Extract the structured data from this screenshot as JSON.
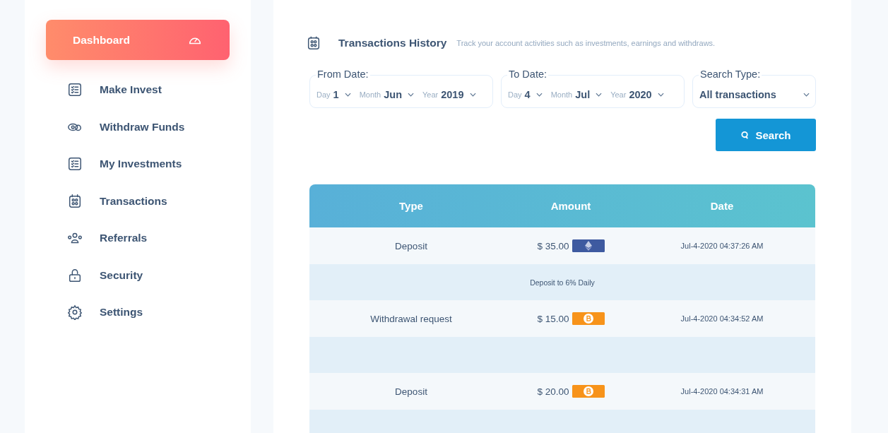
{
  "sidebar": {
    "items": [
      {
        "label": "Dashboard",
        "kind": "gauge",
        "selected": true
      },
      {
        "label": "Make Invest",
        "kind": "checklist",
        "selected": false
      },
      {
        "label": "Withdraw Funds",
        "kind": "coins",
        "selected": false
      },
      {
        "label": "My Investments",
        "kind": "checklist",
        "selected": false
      },
      {
        "label": "Transactions",
        "kind": "calendar",
        "selected": false
      },
      {
        "label": "Referrals",
        "kind": "people",
        "selected": false
      },
      {
        "label": "Security",
        "kind": "lock",
        "selected": false
      },
      {
        "label": "Settings",
        "kind": "gear",
        "selected": false
      }
    ]
  },
  "header": {
    "title": "Transactions History",
    "subtitle": "Track your account activities such as investments, earnings and withdraws."
  },
  "filters": [
    {
      "kind": "date",
      "label": "From Date:",
      "parts": [
        {
          "label": "Day",
          "value": "1"
        },
        {
          "label": "Month",
          "value": "Jun"
        },
        {
          "label": "Year",
          "value": "2019"
        }
      ]
    },
    {
      "kind": "date",
      "label": "To Date:",
      "parts": [
        {
          "label": "Day",
          "value": "4"
        },
        {
          "label": "Month",
          "value": "Jul"
        },
        {
          "label": "Year",
          "value": "2020"
        }
      ]
    },
    {
      "kind": "select",
      "label": "Search Type:",
      "value": "All transactions"
    }
  ],
  "search_button": "Search",
  "table": {
    "columns": [
      "Type",
      "Amount",
      "Date"
    ],
    "rows": [
      {
        "type": "Deposit",
        "amount": "$ 35.00",
        "kind": "eth",
        "date": "Jul-4-2020 04:37:26 AM",
        "note": "Deposit to 6% Daily"
      },
      {
        "type": "Withdrawal request",
        "amount": "$ 15.00",
        "kind": "btc",
        "date": "Jul-4-2020 04:34:52 AM"
      },
      {
        "type": "Deposit",
        "amount": "$ 20.00",
        "kind": "btc",
        "date": "Jul-4-2020 04:34:31 AM"
      }
    ]
  }
}
